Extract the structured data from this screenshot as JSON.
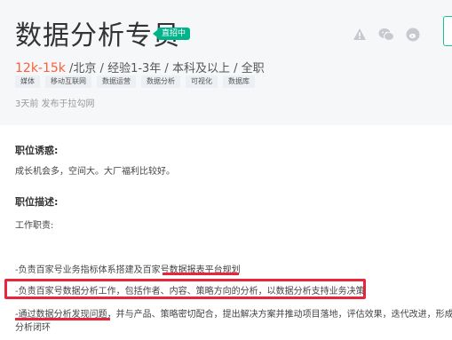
{
  "job": {
    "title": "数据分析专员",
    "badge": "直招中",
    "salary": "12k-15k",
    "details": " /北京 / 经验1-3年 / 本科及以上 / 全职",
    "tags": [
      "媒体",
      "移动互联网",
      "数据运营",
      "数据分析",
      "可视化",
      "数据库"
    ],
    "published": "3天前  发布于拉勾网"
  },
  "header_icons": [
    "warning-icon",
    "wechat-icon",
    "weibo-icon"
  ],
  "perks": {
    "title": "职位诱惑:",
    "text": "成长机会多，空间大。大厂福利比较好。"
  },
  "description": {
    "title": "职位描述:",
    "intro": "工作职责:",
    "items": [
      "-负责百家号业务指标体系搭建及百家号数据报表平台规划",
      "-负责百家号数据分析工作，包括作者、内容、策略方向的分析，以数据分析支持业务决策",
      "-通过数据分析发现问题，并与产品、策略密切配合，提出解决方案并推动项目落地，评估效果，迭代改进，形成",
      "分析闭环"
    ]
  },
  "colors": {
    "accent_green": "#00b38a",
    "salary_orange": "#fd5f39",
    "highlight_red": "#e8263b"
  }
}
